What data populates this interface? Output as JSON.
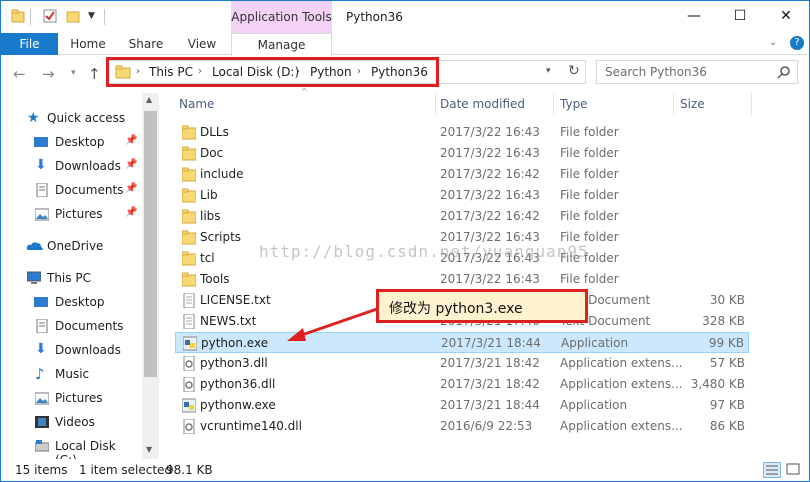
{
  "window": {
    "title": "Python36",
    "context_label": "Application Tools"
  },
  "ribbon": {
    "tabs": {
      "file": "File",
      "home": "Home",
      "share": "Share",
      "view": "View",
      "manage": "Manage"
    }
  },
  "address": {
    "crumbs": [
      "This PC",
      "Local Disk (D:)",
      "Python",
      "Python36"
    ]
  },
  "search": {
    "placeholder": "Search Python36"
  },
  "nav": {
    "quick_access": "Quick access",
    "desktop": "Desktop",
    "downloads": "Downloads",
    "documents": "Documents",
    "pictures": "Pictures",
    "onedrive": "OneDrive",
    "this_pc": "This PC",
    "pc_desktop": "Desktop",
    "pc_documents": "Documents",
    "pc_downloads": "Downloads",
    "pc_music": "Music",
    "pc_pictures": "Pictures",
    "pc_videos": "Videos",
    "pc_local_disk": "Local Disk (C:)"
  },
  "columns": {
    "name": "Name",
    "date": "Date modified",
    "type": "Type",
    "size": "Size"
  },
  "files": [
    {
      "name": "DLLs",
      "date": "2017/3/22 16:43",
      "type": "File folder",
      "size": ""
    },
    {
      "name": "Doc",
      "date": "2017/3/22 16:43",
      "type": "File folder",
      "size": ""
    },
    {
      "name": "include",
      "date": "2017/3/22 16:42",
      "type": "File folder",
      "size": ""
    },
    {
      "name": "Lib",
      "date": "2017/3/22 16:43",
      "type": "File folder",
      "size": ""
    },
    {
      "name": "libs",
      "date": "2017/3/22 16:42",
      "type": "File folder",
      "size": ""
    },
    {
      "name": "Scripts",
      "date": "2017/3/22 16:43",
      "type": "File folder",
      "size": ""
    },
    {
      "name": "tcl",
      "date": "2017/3/22 16:43",
      "type": "File folder",
      "size": ""
    },
    {
      "name": "Tools",
      "date": "2017/3/22 16:43",
      "type": "File folder",
      "size": ""
    },
    {
      "name": "LICENSE.txt",
      "date": "",
      "type": "Text Document",
      "size": "30 KB"
    },
    {
      "name": "NEWS.txt",
      "date": "2017/3/21 17:40",
      "type": "Text Document",
      "size": "328 KB"
    },
    {
      "name": "python.exe",
      "date": "2017/3/21 18:44",
      "type": "Application",
      "size": "99 KB"
    },
    {
      "name": "python3.dll",
      "date": "2017/3/21 18:42",
      "type": "Application extens...",
      "size": "57 KB"
    },
    {
      "name": "python36.dll",
      "date": "2017/3/21 18:42",
      "type": "Application extens...",
      "size": "3,480 KB"
    },
    {
      "name": "pythonw.exe",
      "date": "2017/3/21 18:44",
      "type": "Application",
      "size": "97 KB"
    },
    {
      "name": "vcruntime140.dll",
      "date": "2016/6/9 22:53",
      "type": "Application extens...",
      "size": "86 KB"
    }
  ],
  "watermark": "http://blog.csdn.net/yuanguan95",
  "callout": "修改为 python3.exe",
  "status": {
    "count": "15 items",
    "selected": "1 item selected",
    "size": "98.1 KB"
  },
  "colors": {
    "accent": "#1979ca",
    "context_tab": "#f3d2f5",
    "selection": "#cce8ff",
    "annotation_red": "#e02020",
    "callout_bg": "#fff3cf",
    "folder": "#f8d775"
  }
}
